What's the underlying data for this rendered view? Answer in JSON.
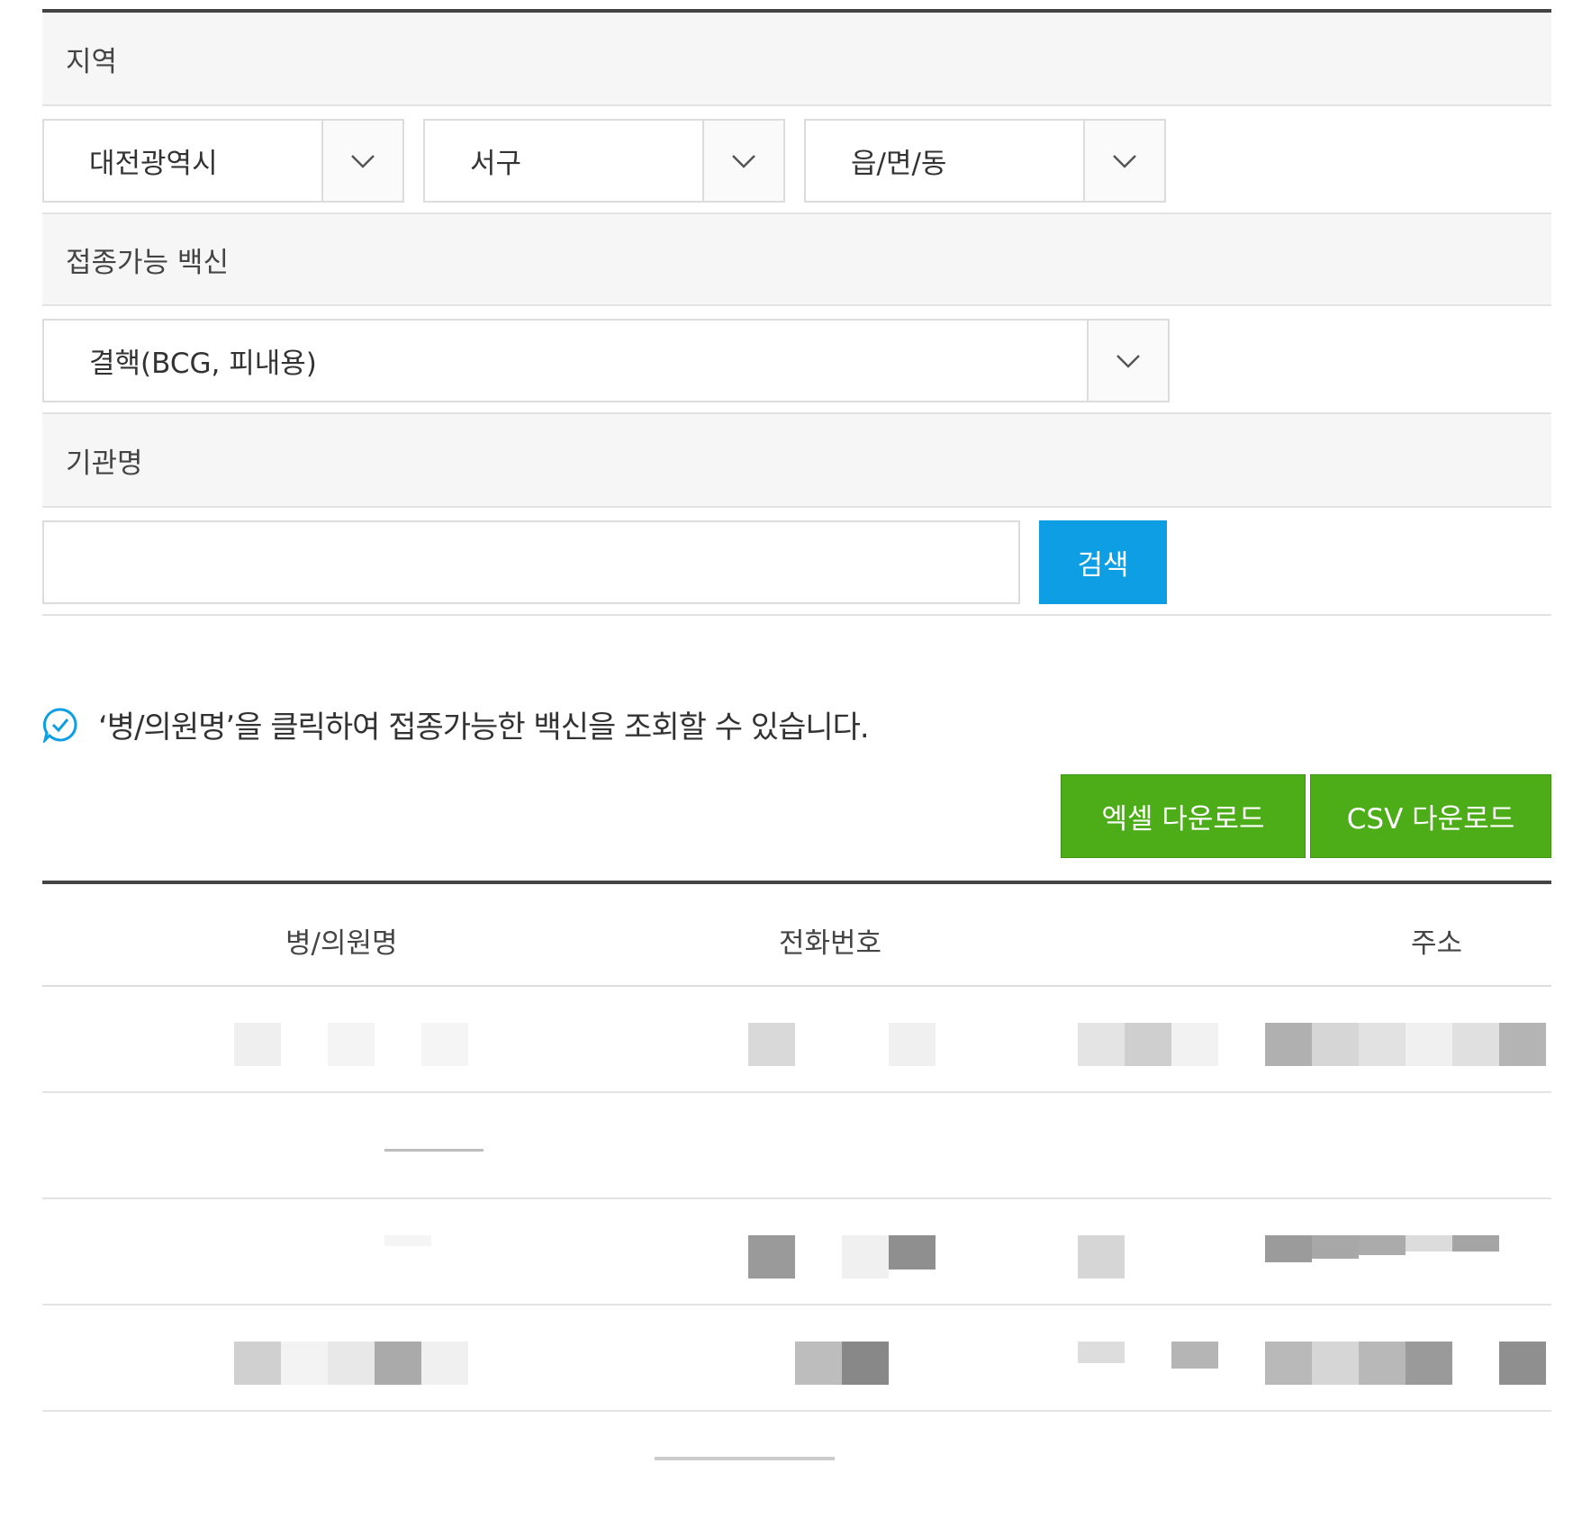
{
  "form": {
    "region_label": "지역",
    "city_select": "대전광역시",
    "district_select": "서구",
    "town_select": "읍/면/동",
    "vaccine_label": "접종가능 백신",
    "vaccine_select": "결핵(BCG, 피내용)",
    "org_label": "기관명",
    "org_input_value": "",
    "search_button": "검색"
  },
  "notice": {
    "text": "‘병/의원명’을 클릭하여 접종가능한 백신을 조회할 수 있습니다."
  },
  "downloads": {
    "excel_button": "엑셀 다운로드",
    "csv_button": "CSV 다운로드"
  },
  "table": {
    "headers": [
      "병/의원명",
      "전화번호",
      "주소"
    ]
  },
  "colors": {
    "search_blue": "#0d9ee3",
    "download_green": "#4cad18",
    "notice_icon": "#0d9ee3"
  }
}
